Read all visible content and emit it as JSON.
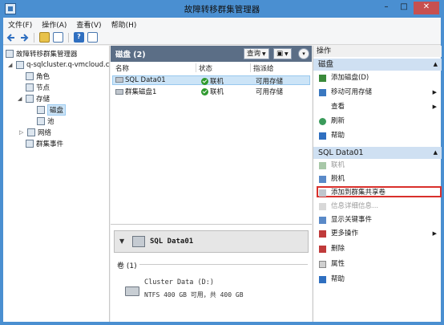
{
  "window": {
    "title": "故障转移群集管理器"
  },
  "menu": [
    "文件(F)",
    "操作(A)",
    "查看(V)",
    "帮助(H)"
  ],
  "tree": {
    "root": "故障转移群集管理器",
    "cluster": "q-sqlcluster.q-vmcloud.c",
    "items": [
      "角色",
      "节点",
      "存储",
      "磁盘",
      "池",
      "网络",
      "群集事件"
    ]
  },
  "main": {
    "header": "磁盘 (2)",
    "query_label": "查询",
    "columns": [
      "名称",
      "状态",
      "指派给"
    ],
    "rows": [
      {
        "name": "SQL Data01",
        "status": "联机",
        "assigned": "可用存储"
      },
      {
        "name": "群集磁盘1",
        "status": "联机",
        "assigned": "可用存储"
      }
    ],
    "detail": {
      "name": "SQL Data01",
      "volume_title": "卷 (1)",
      "volume_name": "Cluster Data (D:)",
      "volume_info": "NTFS 400 GB 可用，共 400 GB"
    }
  },
  "actions": {
    "title": "操作",
    "section1": "磁盘",
    "section1_items": [
      "添加磁盘(D)",
      "移动可用存储",
      "查看",
      "刷新",
      "帮助"
    ],
    "section2": "SQL Data01",
    "section2_items": [
      "联机",
      "脱机",
      "添加到群集共享卷",
      "信息详细信息...",
      "显示关键事件",
      "更多操作",
      "删除",
      "属性",
      "帮助"
    ]
  }
}
